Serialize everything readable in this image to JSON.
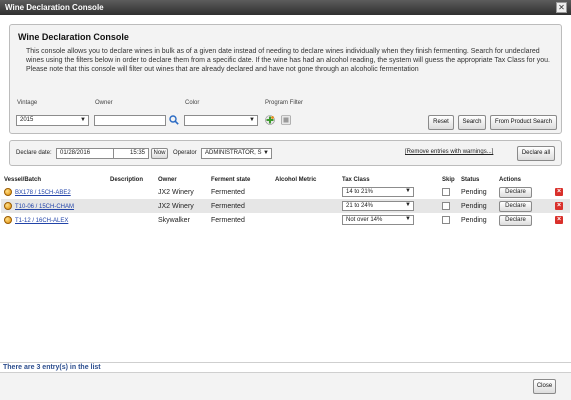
{
  "window": {
    "title": "Wine Declaration Console",
    "close_glyph": "✕"
  },
  "intro": {
    "heading": "Wine Declaration Console",
    "description": "This console allows you to declare wines in bulk as of a given date instead of needing to declare wines individually when they finish fermenting. Search for undeclared wines using the filters below in order to declare them from a specific date. If the wine has had an alcohol reading, the system will guess the appropriate Tax Class for you. Please note that this console will filter out wines that are already declared and have not gone through an alcoholic fermentation"
  },
  "filters": {
    "vintage_label": "Vintage",
    "vintage_value": "2015",
    "owner_label": "Owner",
    "owner_value": "",
    "color_label": "Color",
    "color_value": "",
    "program_filter_label": "Program Filter",
    "reset_label": "Reset",
    "search_label": "Search",
    "from_product_search_label": "From Product Search"
  },
  "declare_bar": {
    "declare_date_label": "Declare date:",
    "date_value": "01/28/2016",
    "time_value": "15:35",
    "now_label": "Now",
    "operator_label": "Operator",
    "operator_value": "ADMINISTRATOR, S",
    "remove_warnings_link": "[Remove entries with warnings...]",
    "declare_all_label": "Declare all"
  },
  "table": {
    "columns": [
      "Vessel/Batch",
      "Description",
      "Owner",
      "Ferment state",
      "Alcohol Metric",
      "Tax Class",
      "Skip",
      "Status",
      "Actions"
    ],
    "rows": [
      {
        "vessel": "BX178 / 15CH-ABE2",
        "description": "",
        "owner": "JX2 Winery",
        "ferment_state": "Fermented",
        "alcohol_metric": "",
        "tax_class": "14 to 21%",
        "status": "Pending",
        "action": "Declare"
      },
      {
        "vessel": "T10-06 / 15CH-CHAM",
        "description": "",
        "owner": "JX2 Winery",
        "ferment_state": "Fermented",
        "alcohol_metric": "",
        "tax_class": "21 to 24%",
        "status": "Pending",
        "action": "Declare"
      },
      {
        "vessel": "T1-12 / 16CH-ALEX",
        "description": "",
        "owner": "Skywalker",
        "ferment_state": "Fermented",
        "alcohol_metric": "",
        "tax_class": "Not over 14%",
        "status": "Pending",
        "action": "Declare"
      }
    ]
  },
  "footer": {
    "entry_count": "There are 3 entry(s) in the list",
    "close_label": "Close"
  },
  "icons": {
    "dropdown_arrow": "▼",
    "search_icon": "search-icon",
    "program_add_icon": "program-add-icon",
    "program_clear_icon": "program-clear-icon",
    "row_icon": "barrel-icon",
    "delete_icon": "delete-icon"
  },
  "colors": {
    "link": "#2143a8",
    "titlebar": "#3a3a3a",
    "delete": "#d9302b",
    "count_text": "#2b4d8e"
  }
}
